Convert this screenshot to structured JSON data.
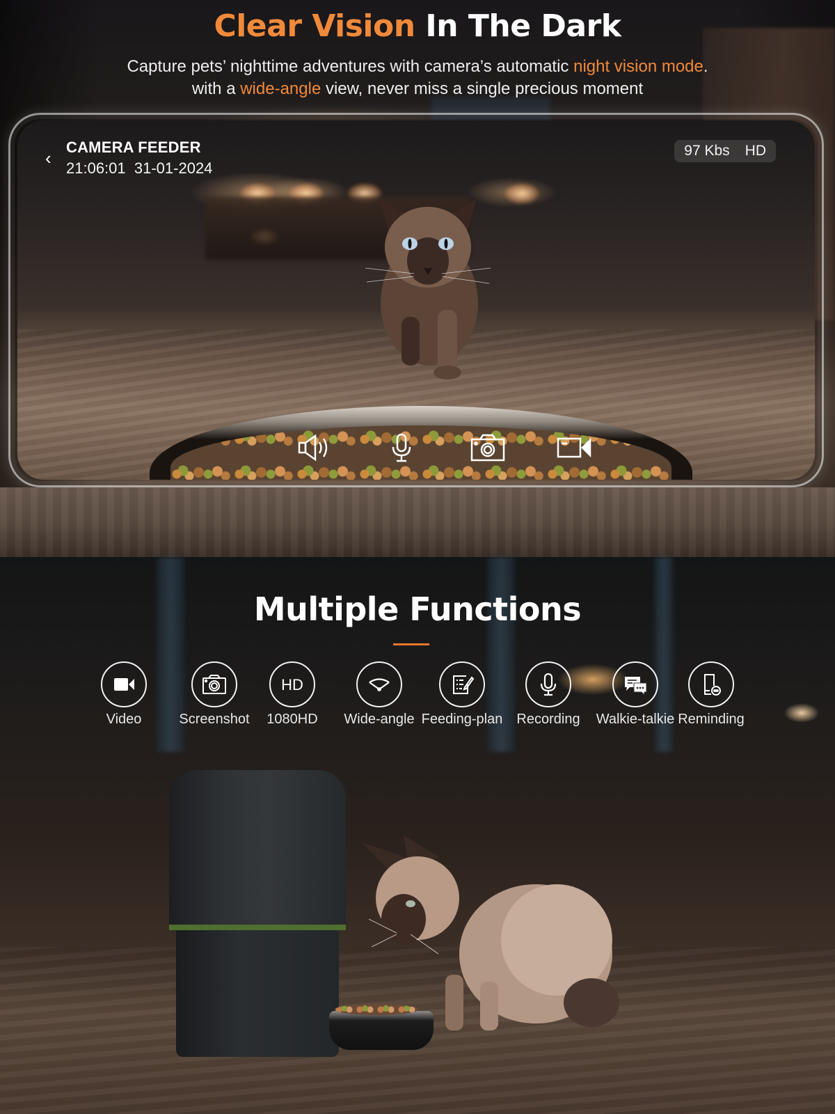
{
  "hero": {
    "title_accent": "Clear Vision",
    "title_rest": " In The Dark",
    "subtitle_line1_pre": "Capture pets’ nighttime adventures with camera’s automatic ",
    "subtitle_line1_accent": "night vision mode",
    "subtitle_line1_post": ".",
    "subtitle_line2_pre": "with a ",
    "subtitle_line2_accent": "wide-angle",
    "subtitle_line2_post": " view, never miss a single precious moment"
  },
  "camera_app": {
    "back_icon": "chevron-left-icon",
    "device_name": "CAMERA FEEDER",
    "time": "21:06:01",
    "date": "31-01-2024",
    "bitrate": "97 Kbs",
    "quality": "HD",
    "controls": [
      {
        "name": "speaker",
        "icon": "speaker-icon"
      },
      {
        "name": "microphone",
        "icon": "microphone-icon"
      },
      {
        "name": "screenshot",
        "icon": "camera-icon"
      },
      {
        "name": "record-video",
        "icon": "video-camera-icon"
      }
    ]
  },
  "functions": {
    "title": "Multiple Functions",
    "items": [
      {
        "label": "Video",
        "icon": "video-camera-icon"
      },
      {
        "label": "Screenshot",
        "icon": "camera-icon"
      },
      {
        "label": "1080HD",
        "icon": "hd-icon"
      },
      {
        "label": "Wide-angle",
        "icon": "wide-angle-icon"
      },
      {
        "label": "Feeding-plan",
        "icon": "feeding-plan-icon"
      },
      {
        "label": "Recording",
        "icon": "microphone-icon"
      },
      {
        "label": "Walkie-talkie",
        "icon": "chat-bubbles-icon"
      },
      {
        "label": "Reminding",
        "icon": "phone-message-icon"
      }
    ]
  },
  "colors": {
    "accent": "#f08a3a",
    "divider": "#e7772d",
    "feeder_band": "#4f6f2e"
  }
}
